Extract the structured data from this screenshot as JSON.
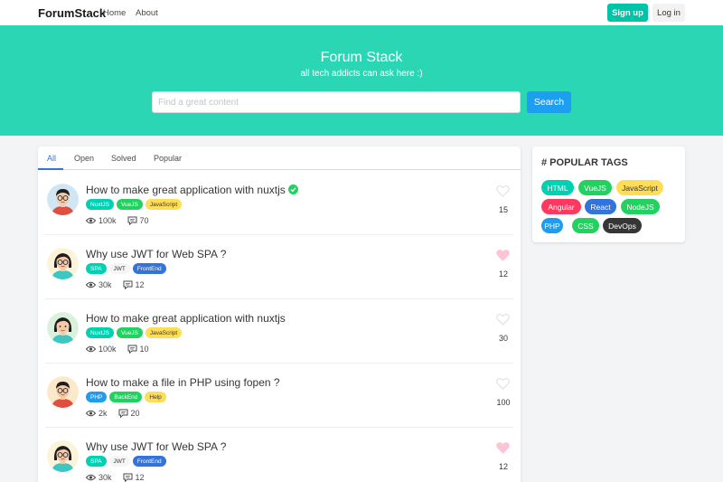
{
  "navbar": {
    "brand": "ForumStack",
    "links": [
      "Home",
      "About"
    ],
    "signup_label": "Sign up",
    "login_label": "Log in"
  },
  "hero": {
    "title": "Forum Stack",
    "subtitle": "all tech addicts can ask here :)",
    "search_placeholder": "Find a great content",
    "search_button": "Search"
  },
  "tabs": [
    "All",
    "Open",
    "Solved",
    "Popular"
  ],
  "active_tab": "All",
  "posts": [
    {
      "title": "How to make great application with nuxtjs",
      "solved": true,
      "tags": [
        "NuxtJS",
        "VueJS",
        "JavaScript"
      ],
      "views": "100k",
      "comments": "70",
      "likes": "15",
      "liked": false,
      "avatar": "avatar-man-glasses"
    },
    {
      "title": "Why use JWT for Web SPA ?",
      "solved": false,
      "tags": [
        "SPA",
        "JWT",
        "FrontEnd"
      ],
      "views": "30k",
      "comments": "12",
      "likes": "12",
      "liked": true,
      "avatar": "avatar-woman-glasses"
    },
    {
      "title": "How to make great application with nuxtjs",
      "solved": false,
      "tags": [
        "NuxtJS",
        "VueJS",
        "JavaScript"
      ],
      "views": "100k",
      "comments": "10",
      "likes": "30",
      "liked": false,
      "avatar": "avatar-woman"
    },
    {
      "title": "How to make a file in PHP using fopen ?",
      "solved": false,
      "tags": [
        "PHP",
        "BackEnd",
        "Help"
      ],
      "views": "2k",
      "comments": "20",
      "likes": "100",
      "liked": false,
      "avatar": "avatar-man-glasses-2"
    },
    {
      "title": "Why use JWT for Web SPA ?",
      "solved": false,
      "tags": [
        "SPA",
        "JWT",
        "FrontEnd"
      ],
      "views": "30k",
      "comments": "12",
      "likes": "12",
      "liked": true,
      "avatar": "avatar-woman-glasses"
    }
  ],
  "popular_tags_title": "# POPULAR TAGS",
  "popular_tags": [
    "HTML",
    "VueJS",
    "JavaScript",
    "Angular",
    "React",
    "NodeJS",
    "PHP",
    "CSS",
    "DevOps"
  ],
  "tag_colors": {
    "NuxtJS": "#00d1b2",
    "VueJS": "#23d160",
    "JavaScript": "#ffdd57",
    "SPA": "#00d1b2",
    "JWT": "#f5f5f5",
    "FrontEnd": "#3273dc",
    "PHP": "#209cee",
    "BackEnd": "#23d160",
    "Help": "#ffdd57",
    "HTML": "#00d1b2",
    "Angular": "#ff3860",
    "React": "#3273dc",
    "NodeJS": "#23d160",
    "CSS": "#23d160",
    "DevOps": "#363636"
  },
  "colors": {
    "primary": "#00c4a7",
    "hero": "#2bd6b5",
    "info": "#1e9ef0",
    "link": "#3273dc",
    "heart_liked": "#ffc4d3",
    "heart_empty": "#dddddd"
  }
}
